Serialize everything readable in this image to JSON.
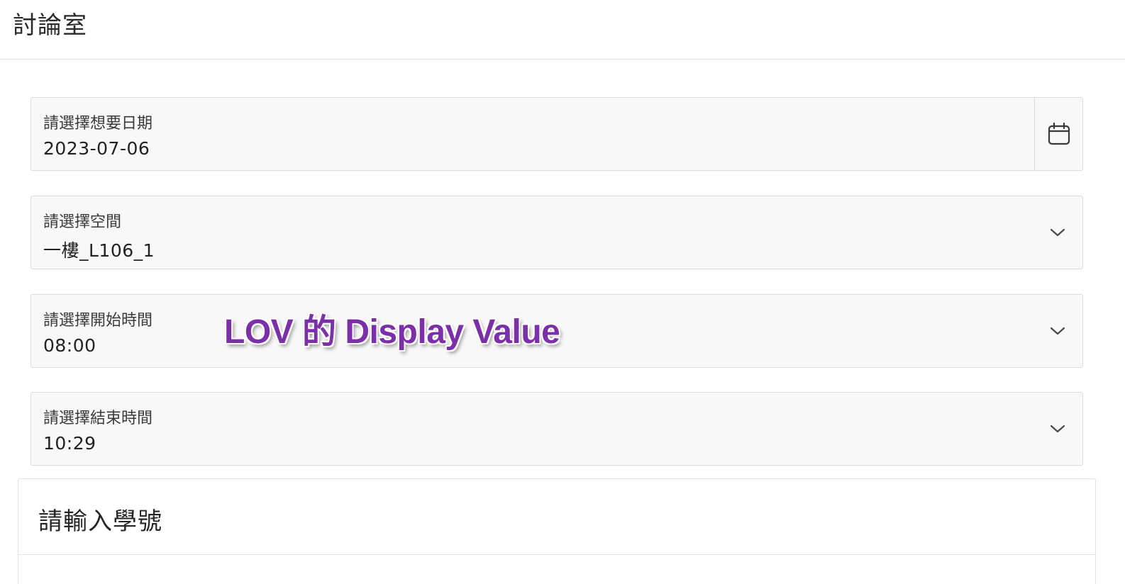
{
  "header": {
    "title": "討論室"
  },
  "fields": {
    "date": {
      "label": "請選擇想要日期",
      "value": "2023-07-06",
      "icon": "calendar-icon"
    },
    "space": {
      "label": "請選擇空間",
      "value": "一樓_L106_1",
      "icon": "chevron-down-icon"
    },
    "start": {
      "label": "請選擇開始時間",
      "value": "08:00",
      "icon": "chevron-down-icon"
    },
    "end": {
      "label": "請選擇結束時間",
      "value": "10:29",
      "icon": "chevron-down-icon"
    }
  },
  "annotation": {
    "text": "LOV 的 Display Value",
    "color": "#7b2fa8"
  },
  "region": {
    "title": "請輸入學號"
  }
}
